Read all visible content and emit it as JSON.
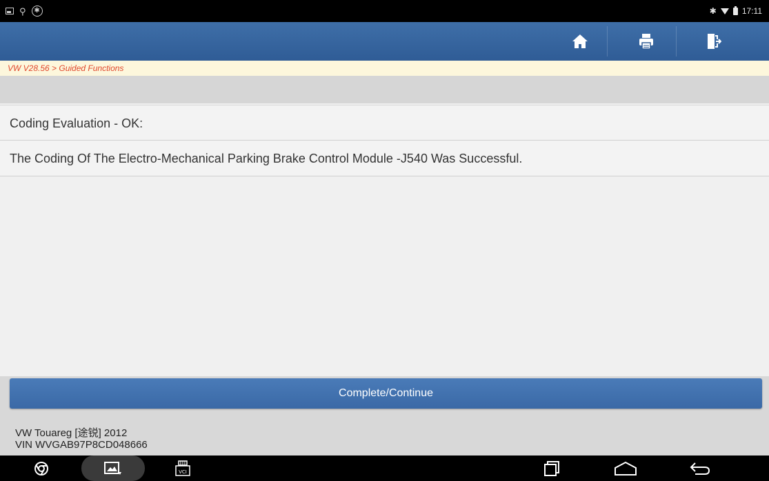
{
  "status_bar": {
    "time": "17:11"
  },
  "toolbar": {
    "home_icon": "home-icon",
    "print_icon": "print-icon",
    "exit_icon": "exit-icon"
  },
  "breadcrumb": {
    "text": "VW V28.56 > Guided Functions"
  },
  "content": {
    "rows": [
      {
        "text": "Coding Evaluation - OK:"
      },
      {
        "text": "The Coding Of The Electro-Mechanical Parking Brake Control Module -J540 Was Successful."
      }
    ]
  },
  "footer": {
    "continue_label": "Complete/Continue",
    "vehicle": "VW Touareg [途锐] 2012",
    "vin": "VIN WVGAB97P8CD048666"
  },
  "nav_bar": {
    "vci_label": "VCI"
  },
  "colors": {
    "toolbar_blue": "#3a69a6",
    "breadcrumb_red": "#e0472c",
    "breadcrumb_bg": "#fdf7dc"
  }
}
